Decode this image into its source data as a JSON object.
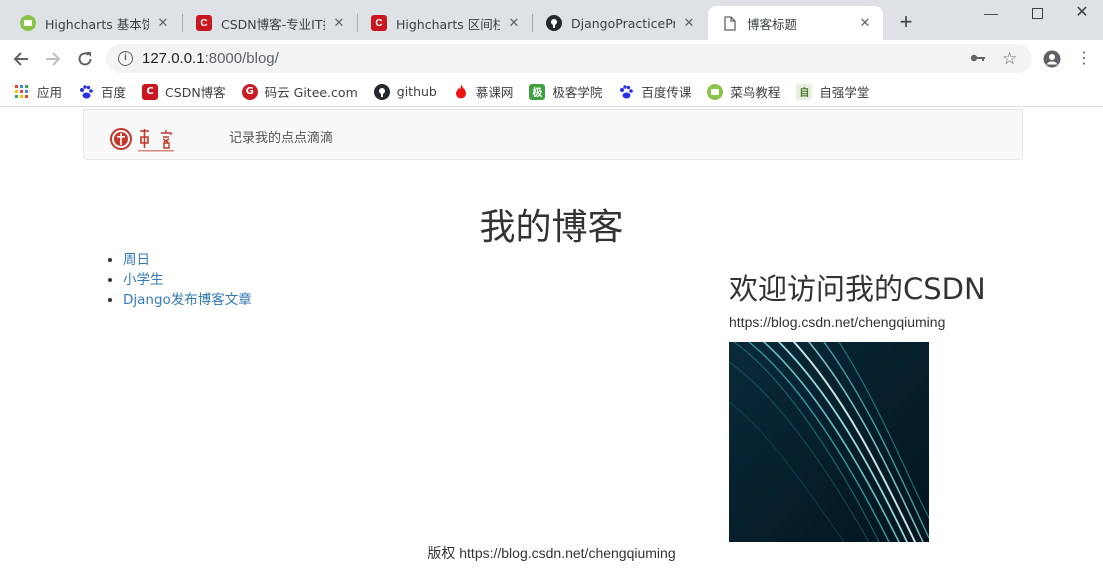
{
  "browser": {
    "tabs": [
      {
        "title": "Highcharts 基本饼图",
        "favicon": "runoob-icon"
      },
      {
        "title": "CSDN博客-专业IT技",
        "favicon": "csdn-icon"
      },
      {
        "title": "Highcharts 区间柱形",
        "favicon": "csdn-icon"
      },
      {
        "title": "DjangoPracticeProj",
        "favicon": "github-icon"
      },
      {
        "title": "博客标题",
        "favicon": "page-icon"
      }
    ],
    "active_tab_index": 4,
    "url_host": "127.0.0.1",
    "url_path": ":8000/blog/",
    "bookmarks": [
      {
        "label": "应用",
        "icon": "apps-icon"
      },
      {
        "label": "百度",
        "icon": "baidu-icon"
      },
      {
        "label": "CSDN博客",
        "icon": "csdn-icon"
      },
      {
        "label": "码云 Gitee.com",
        "icon": "gitee-icon"
      },
      {
        "label": "github",
        "icon": "github-icon"
      },
      {
        "label": "慕课网",
        "icon": "imooc-icon"
      },
      {
        "label": "极客学院",
        "icon": "jike-icon"
      },
      {
        "label": "百度传课",
        "icon": "baidu-icon"
      },
      {
        "label": "菜鸟教程",
        "icon": "runoob-icon"
      },
      {
        "label": "自强学堂",
        "icon": "ziqiang-icon"
      }
    ]
  },
  "navbar": {
    "motto": "记录我的点点滴滴",
    "logo_text": "博客"
  },
  "page": {
    "title": "我的博客",
    "posts": [
      "周日",
      "小学生",
      "Django发布博客文章"
    ]
  },
  "sidebar": {
    "heading": "欢迎访问我的CSDN",
    "url": "https://blog.csdn.net/chengqiuming"
  },
  "footer": {
    "label": "版权",
    "url": "https://blog.csdn.net/chengqiuming"
  },
  "colors": {
    "link": "#337ab7",
    "csdn_red": "#c9171f",
    "active_tab": "#ffffff",
    "tabbar": "#dee1e6"
  }
}
